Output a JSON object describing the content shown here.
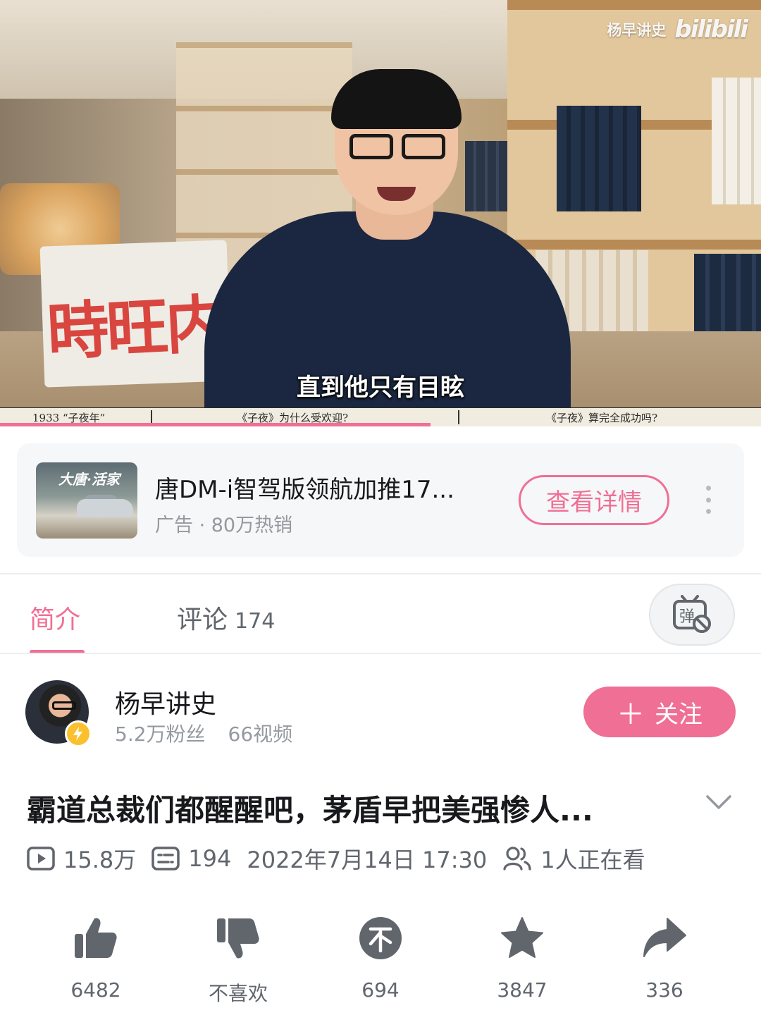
{
  "video": {
    "watermark_name": "杨早讲史",
    "watermark_logo": "bilibili",
    "subtitle": "直到他只有目眩",
    "bag_text": "時旺内",
    "chapters": [
      "1933 “子夜年”",
      "《子夜》为什么受欢迎?",
      "《子夜》算完全成功吗?"
    ],
    "progress_fraction": 0.566
  },
  "ad": {
    "thumb_text": "大唐·活家",
    "title": "唐DM-i智驾版领航加推17...",
    "subtitle": "广告 · 80万热销",
    "button_label": "查看详情",
    "more_icon": "more-vertical-icon"
  },
  "tabs": {
    "intro_label": "简介",
    "comments_label": "评论",
    "comments_count": "174",
    "danmaku_icon": "danmaku-off-icon"
  },
  "uploader": {
    "name": "杨早讲史",
    "fans": "5.2万粉丝",
    "videos": "66视频",
    "follow_label": "关注"
  },
  "title": "霸道总裁们都醒醒吧，茅盾早把美强惨人...",
  "meta": {
    "views": "15.8万",
    "danmaku_count": "194",
    "datetime": "2022年7月14日 17:30",
    "watching": "1人正在看"
  },
  "actions": {
    "like": "6482",
    "dislike": "不喜欢",
    "coin": "694",
    "favorite": "3847",
    "share": "336"
  },
  "colors": {
    "accent": "#f06f95",
    "text_primary": "#18191c",
    "text_secondary": "#61666d",
    "text_tertiary": "#9499a0",
    "icon": "#61666d"
  }
}
